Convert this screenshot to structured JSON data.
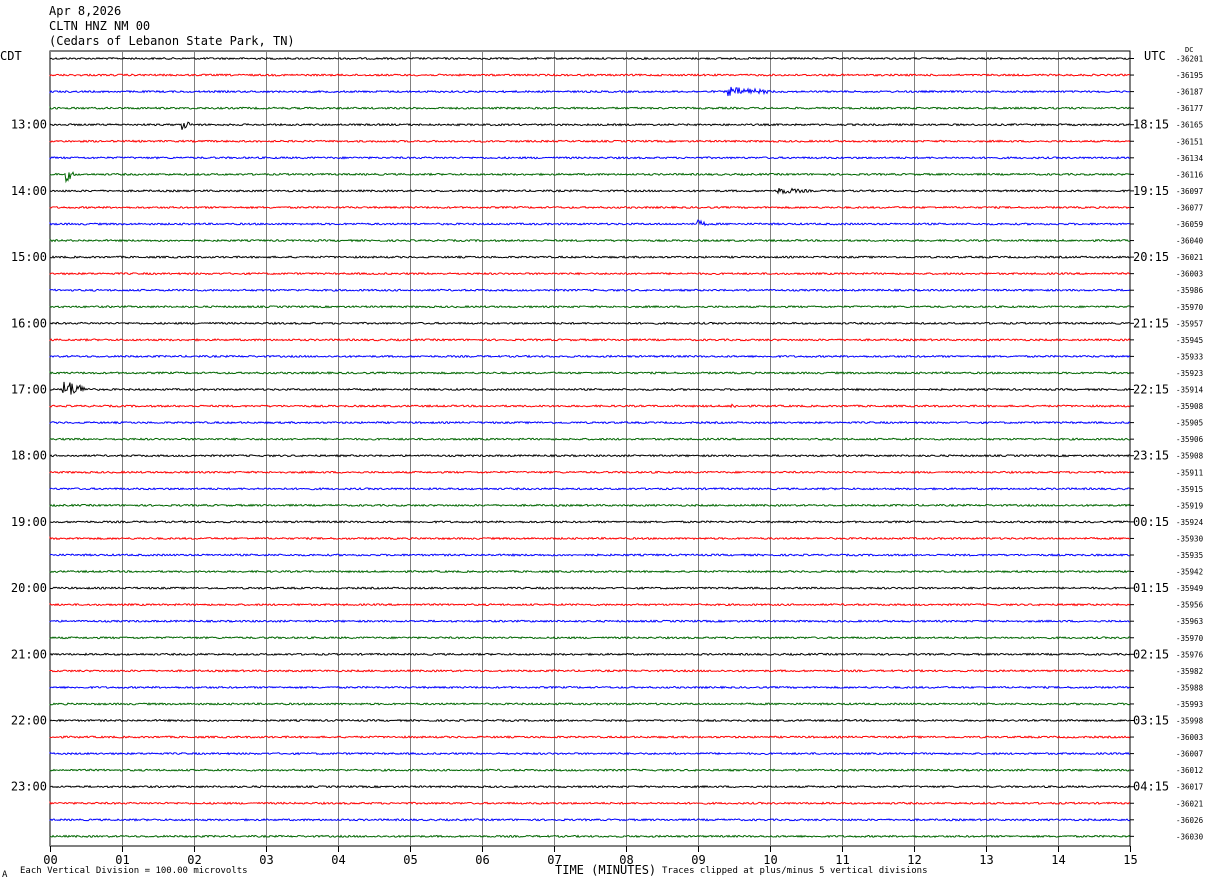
{
  "header": {
    "date": "Apr 8,2026",
    "station": "CLTN HNZ NM 00",
    "location": "(Cedars of Lebanon State Park, TN)"
  },
  "corner": {
    "left_tz": "CDT",
    "right_tz": "UTC",
    "dc_label": "DC"
  },
  "footer": {
    "vertical_division": "Each Vertical Division =  100.00 microvolts",
    "time_axis": "TIME (MINUTES)",
    "clip_note": "Traces clipped at plus/minus 5 vertical divisions",
    "corner_mark": "A"
  },
  "chart_data": {
    "type": "line",
    "xlabel": "TIME (MINUTES)",
    "x_ticks": [
      "00",
      "01",
      "02",
      "03",
      "04",
      "05",
      "06",
      "07",
      "08",
      "09",
      "10",
      "11",
      "12",
      "13",
      "14",
      "15"
    ],
    "xlim": [
      0,
      15
    ],
    "trace_colors": [
      "#000000",
      "#ff0000",
      "#0000ff",
      "#006600"
    ],
    "grid_color": "#808080",
    "left_hour_labels": [
      "13:00",
      "14:00",
      "15:00",
      "16:00",
      "17:00",
      "18:00",
      "19:00",
      "20:00",
      "21:00",
      "22:00",
      "23:00"
    ],
    "right_hour_labels": [
      "18:15",
      "19:15",
      "20:15",
      "21:15",
      "22:15",
      "23:15",
      "00:15",
      "01:15",
      "02:15",
      "03:15",
      "04:15"
    ],
    "hour_label_start_row": 4,
    "dc_offsets": [
      "-36201",
      "-36195",
      "-36187",
      "-36177",
      "-36165",
      "-36151",
      "-36134",
      "-36116",
      "-36097",
      "-36077",
      "-36059",
      "-36040",
      "-36021",
      "-36003",
      "-35986",
      "-35970",
      "-35957",
      "-35945",
      "-35933",
      "-35923",
      "-35914",
      "-35908",
      "-35905",
      "-35906",
      "-35908",
      "-35911",
      "-35915",
      "-35919",
      "-35924",
      "-35930",
      "-35935",
      "-35942",
      "-35949",
      "-35956",
      "-35963",
      "-35970",
      "-35976",
      "-35982",
      "-35988",
      "-35993",
      "-35998",
      "-36003",
      "-36007",
      "-36012",
      "-36017",
      "-36021",
      "-36026",
      "-36030"
    ],
    "trace_end_minutes": [
      15,
      15,
      15,
      15,
      15,
      15,
      15,
      15,
      15,
      15,
      15,
      15,
      15,
      15,
      15,
      15,
      15,
      15,
      15,
      15,
      15,
      15,
      15,
      15,
      15,
      15,
      15,
      15,
      15,
      15,
      15,
      15,
      15,
      15,
      15,
      15,
      15,
      15,
      15,
      15,
      15,
      15,
      15,
      15,
      15,
      15,
      15,
      15
    ],
    "events": [
      {
        "row": 2,
        "minute": 9.4,
        "amplitude": 0.5,
        "duration": 0.7
      },
      {
        "row": 4,
        "minute": 1.83,
        "amplitude": 0.6,
        "duration": 0.15
      },
      {
        "row": 7,
        "minute": 0.22,
        "amplitude": 0.8,
        "duration": 0.15
      },
      {
        "row": 8,
        "minute": 10.1,
        "amplitude": 0.3,
        "duration": 0.5
      },
      {
        "row": 10,
        "minute": 8.95,
        "amplitude": 0.5,
        "duration": 0.2
      },
      {
        "row": 20,
        "minute": 0.18,
        "amplitude": 1.1,
        "duration": 0.4
      },
      {
        "row": 21,
        "minute": 9.45,
        "amplitude": 0.3,
        "duration": 0.1
      }
    ]
  }
}
